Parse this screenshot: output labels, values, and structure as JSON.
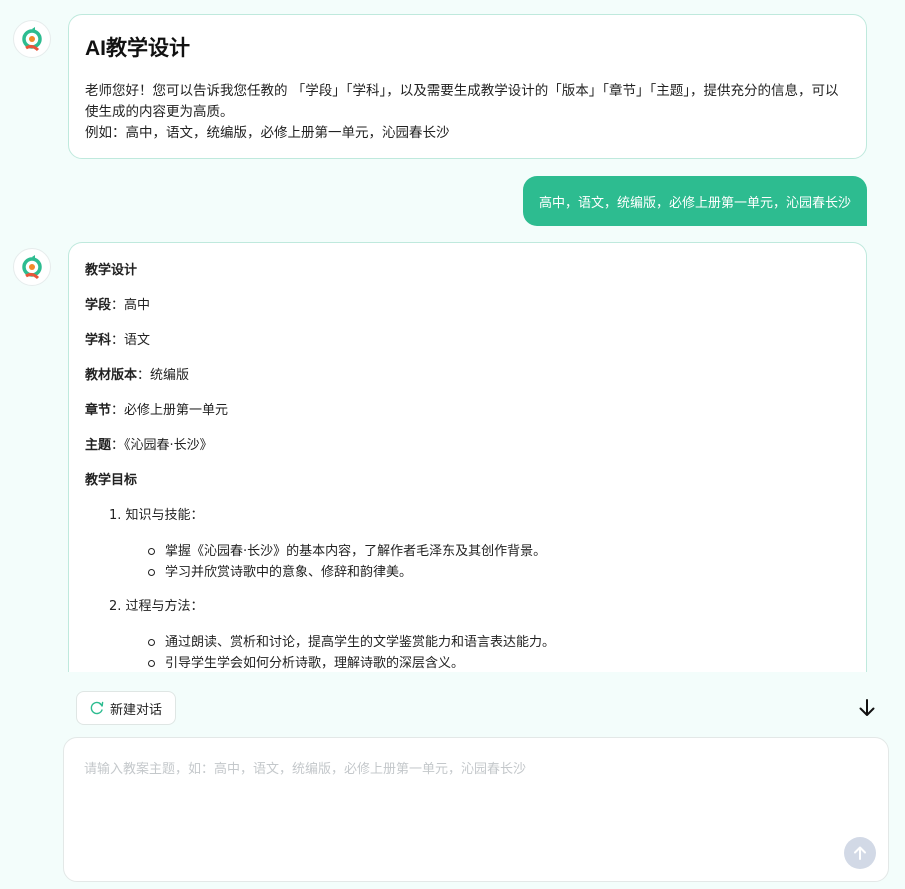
{
  "messages": {
    "welcome": {
      "title": "AI教学设计",
      "line1": "老师您好！您可以告诉我您任教的 「学段」「学科」，以及需要生成教学设计的「版本」「章节」「主题」，提供充分的信息，可以使生成的内容更为高质。",
      "line2": "例如：高中，语文，统编版，必修上册第一单元，沁园春长沙"
    },
    "user": {
      "text": "高中，语文，统编版，必修上册第一单元，沁园春长沙"
    },
    "response": {
      "heading": "教学设计",
      "fields": [
        {
          "label": "学段",
          "value": "：高中"
        },
        {
          "label": "学科",
          "value": "：语文"
        },
        {
          "label": "教材版本",
          "value": "：统编版"
        },
        {
          "label": "章节",
          "value": "：必修上册第一单元"
        },
        {
          "label": "主题",
          "value": "：《沁园春·长沙》"
        }
      ],
      "goals_heading": "教学目标",
      "goals": [
        {
          "title": "1. 知识与技能：",
          "items": [
            "掌握《沁园春·长沙》的基本内容，了解作者毛泽东及其创作背景。",
            "学习并欣赏诗歌中的意象、修辞和韵律美。"
          ]
        },
        {
          "title": "2. 过程与方法：",
          "items": [
            "通过朗读、赏析和讨论，提高学生的文学鉴赏能力和语言表达能力。",
            "引导学生学会如何分析诗歌，理解诗歌的深层含义。"
          ]
        }
      ]
    }
  },
  "toolbar": {
    "new_chat_label": "新建对话"
  },
  "input": {
    "placeholder": "请输入教案主题，如：高中，语文，统编版，必修上册第一单元，沁园春长沙",
    "value": ""
  },
  "icons": {
    "bot_avatar": "bot-logo-icon",
    "new_chat": "new-chat-icon",
    "scroll_down": "arrow-down-icon",
    "send": "arrow-up-icon"
  },
  "colors": {
    "accent": "#2dbc90",
    "background": "#f3fdfb",
    "bubble_border": "#bfe9dd",
    "send_disabled": "#d2d9e6"
  }
}
